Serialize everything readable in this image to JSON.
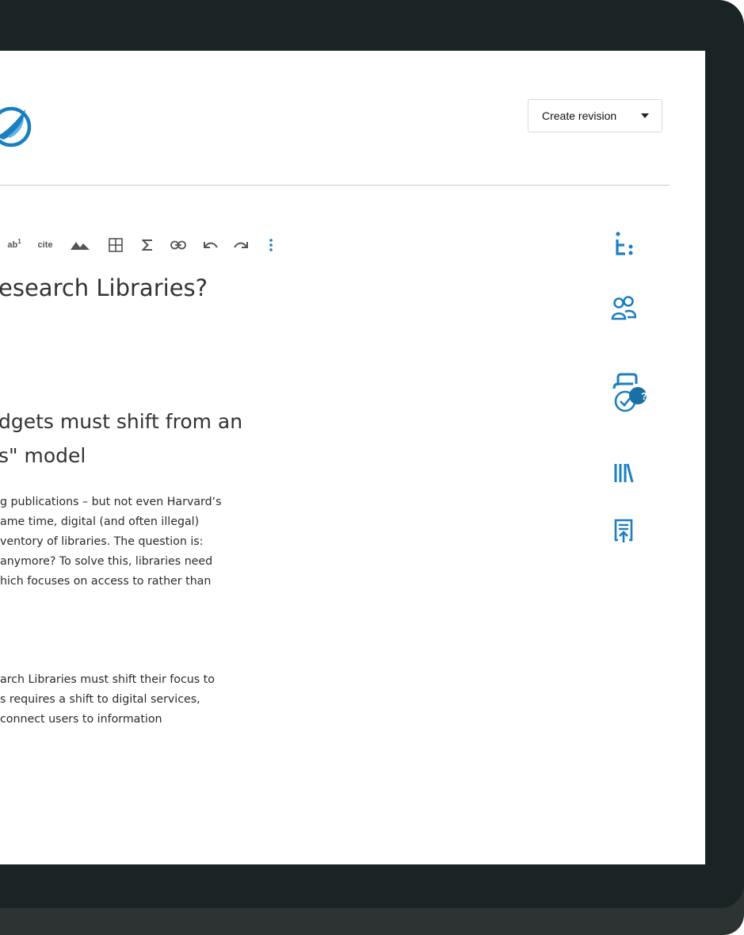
{
  "header": {
    "revision_button_label": "Create revision",
    "brand_color": "#1a7fc1"
  },
  "toolbar": {
    "superscript_label": "ab",
    "superscript_index": "1",
    "cite_label": "cite"
  },
  "document": {
    "title": "esearch Libraries?",
    "heading_lines": [
      "dgets must shift from an",
      "s\" model"
    ],
    "paragraph1_lines": [
      "g publications – but not even Harvard‘s",
      "ame time, digital (and often illegal)",
      "ventory of libraries. The question is:",
      " anymore?  To solve this, libraries need",
      "hich focuses on access to rather than"
    ],
    "paragraph2_lines": [
      "arch Libraries must shift their focus to",
      "s requires a shift to digital services,",
      " connect users to information"
    ]
  },
  "sidebar": {
    "badge_text": "?",
    "icons": [
      "tag-icon",
      "collaborators-icon",
      "review-icon",
      "library-icon",
      "export-icon"
    ]
  },
  "colors": {
    "frame": "#1a2424",
    "accent": "#1a7fc1",
    "badge": "#1a6fa5"
  }
}
